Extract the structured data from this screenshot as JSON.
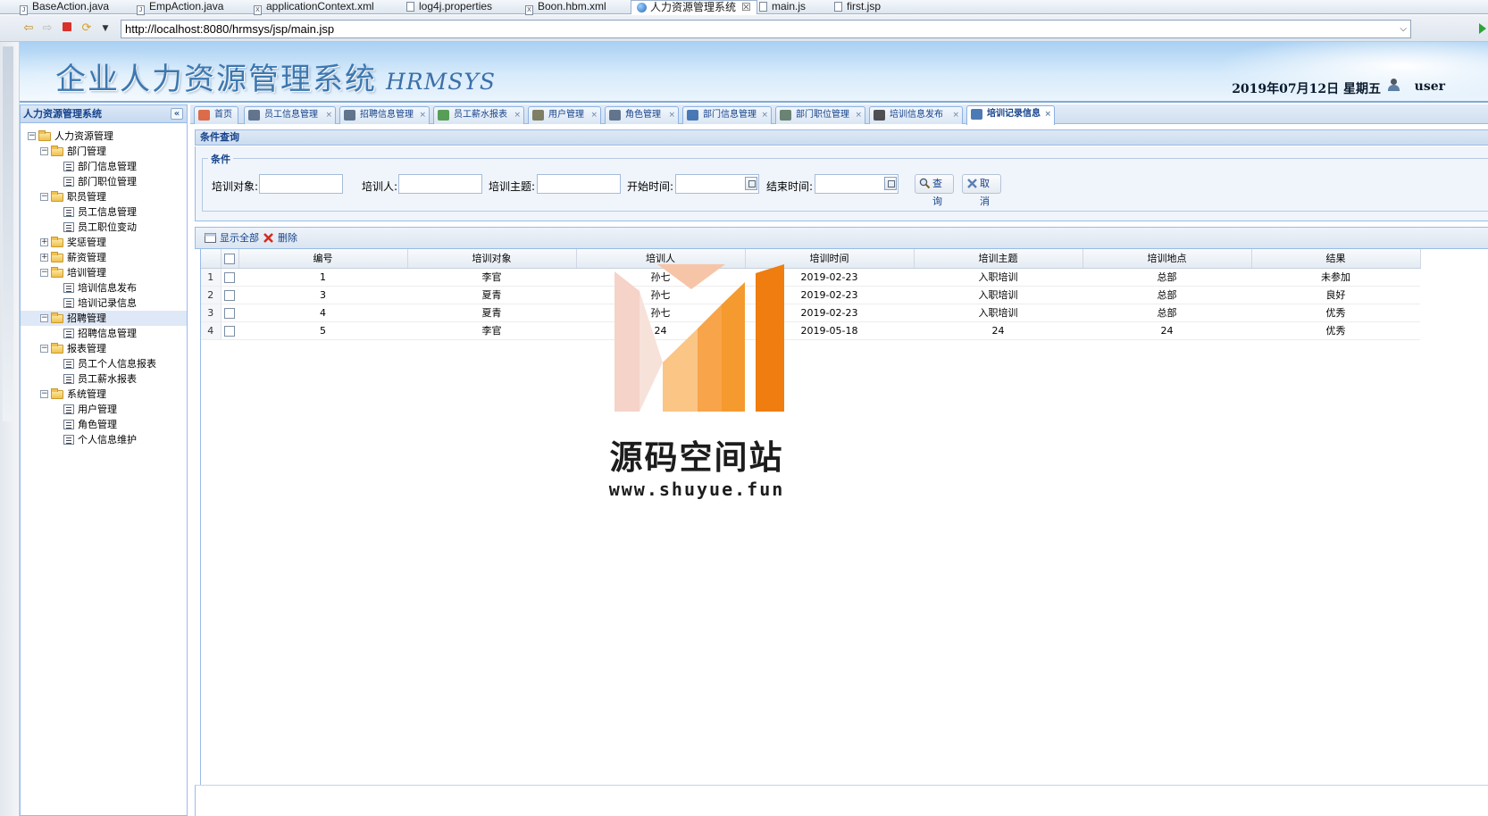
{
  "editor_tabs": [
    {
      "label": "BaseAction.java",
      "icon": "java-file-icon"
    },
    {
      "label": "EmpAction.java",
      "icon": "java-file-icon"
    },
    {
      "label": "applicationContext.xml",
      "icon": "xml-file-icon"
    },
    {
      "label": "log4j.properties",
      "icon": "properties-file-icon"
    },
    {
      "label": "Boon.hbm.xml",
      "icon": "xml-file-icon"
    },
    {
      "label": "人力资源管理系统",
      "icon": "globe-icon",
      "active": true,
      "close": "☒"
    },
    {
      "label": "main.js",
      "icon": "js-file-icon"
    },
    {
      "label": "first.jsp",
      "icon": "jsp-file-icon"
    }
  ],
  "browser": {
    "url": "http://localhost:8080/hrmsys/jsp/main.jsp"
  },
  "header": {
    "title": "企业人力资源管理系统",
    "subtitle": "HRMSYS",
    "date": "2019年07月12日 星期五",
    "user": "user"
  },
  "sidebar": {
    "title": "人力资源管理系统",
    "collapse_icon": "«",
    "tree": [
      {
        "label": "人力资源管理",
        "level": 0,
        "type": "folder",
        "expand": "−"
      },
      {
        "label": "部门管理",
        "level": 1,
        "type": "folder",
        "expand": "−"
      },
      {
        "label": "部门信息管理",
        "level": 2,
        "type": "leaf"
      },
      {
        "label": "部门职位管理",
        "level": 2,
        "type": "leaf"
      },
      {
        "label": "职员管理",
        "level": 1,
        "type": "folder",
        "expand": "−"
      },
      {
        "label": "员工信息管理",
        "level": 2,
        "type": "leaf"
      },
      {
        "label": "员工职位变动",
        "level": 2,
        "type": "leaf"
      },
      {
        "label": "奖惩管理",
        "level": 1,
        "type": "folder",
        "expand": "+"
      },
      {
        "label": "薪资管理",
        "level": 1,
        "type": "folder",
        "expand": "+"
      },
      {
        "label": "培训管理",
        "level": 1,
        "type": "folder",
        "expand": "−"
      },
      {
        "label": "培训信息发布",
        "level": 2,
        "type": "leaf"
      },
      {
        "label": "培训记录信息",
        "level": 2,
        "type": "leaf"
      },
      {
        "label": "招聘管理",
        "level": 1,
        "type": "folder",
        "expand": "−",
        "selected": true
      },
      {
        "label": "招聘信息管理",
        "level": 2,
        "type": "leaf"
      },
      {
        "label": "报表管理",
        "level": 1,
        "type": "folder",
        "expand": "−"
      },
      {
        "label": "员工个人信息报表",
        "level": 2,
        "type": "leaf"
      },
      {
        "label": "员工薪水报表",
        "level": 2,
        "type": "leaf"
      },
      {
        "label": "系统管理",
        "level": 1,
        "type": "folder",
        "expand": "−"
      },
      {
        "label": "用户管理",
        "level": 2,
        "type": "leaf"
      },
      {
        "label": "角色管理",
        "level": 2,
        "type": "leaf"
      },
      {
        "label": "个人信息维护",
        "level": 2,
        "type": "leaf"
      }
    ]
  },
  "page_tabs": [
    {
      "label": "首页",
      "icon": "home-icon",
      "closable": false
    },
    {
      "label": "员工信息管理",
      "icon": "user-icon",
      "closable": true
    },
    {
      "label": "招聘信息管理",
      "icon": "list-icon",
      "closable": true
    },
    {
      "label": "员工薪水报表",
      "icon": "yen-icon",
      "closable": true
    },
    {
      "label": "用户管理",
      "icon": "user-card-icon",
      "closable": true
    },
    {
      "label": "角色管理",
      "icon": "role-icon",
      "closable": true
    },
    {
      "label": "部门信息管理",
      "icon": "monitor-icon",
      "closable": true
    },
    {
      "label": "部门职位管理",
      "icon": "calc-icon",
      "closable": true
    },
    {
      "label": "培训信息发布",
      "icon": "lines-icon",
      "closable": true
    },
    {
      "label": "培训记录信息",
      "icon": "table-icon",
      "closable": true,
      "active": true
    }
  ],
  "close_glyph": "×",
  "query_panel": {
    "title": "条件查询",
    "legend": "条件",
    "fields": {
      "target_label": "培训对象:",
      "trainer_label": "培训人:",
      "topic_label": "培训主题:",
      "start_label": "开始时间:",
      "end_label": "结束时间:"
    },
    "search_button": "查询",
    "cancel_button": "取消"
  },
  "grid_toolbar": {
    "show_all": "显示全部",
    "delete": "删除"
  },
  "grid": {
    "columns": [
      "编号",
      "培训对象",
      "培训人",
      "培训时间",
      "培训主题",
      "培训地点",
      "结果"
    ],
    "rows": [
      {
        "rownum": "1",
        "cells": [
          "1",
          "李官",
          "孙七",
          "2019-02-23",
          "入职培训",
          "总部",
          "未参加"
        ]
      },
      {
        "rownum": "2",
        "cells": [
          "3",
          "夏青",
          "孙七",
          "2019-02-23",
          "入职培训",
          "总部",
          "良好"
        ]
      },
      {
        "rownum": "3",
        "cells": [
          "4",
          "夏青",
          "孙七",
          "2019-02-23",
          "入职培训",
          "总部",
          "优秀"
        ]
      },
      {
        "rownum": "4",
        "cells": [
          "5",
          "李官",
          "24",
          "2019-05-18",
          "24",
          "24",
          "优秀"
        ]
      }
    ]
  },
  "watermark": {
    "name": "源码空间站",
    "url": "www.shuyue.fun",
    "colors": [
      "#f5d3c8",
      "#f7b36a",
      "#f59a2f",
      "#ef7d10"
    ]
  }
}
